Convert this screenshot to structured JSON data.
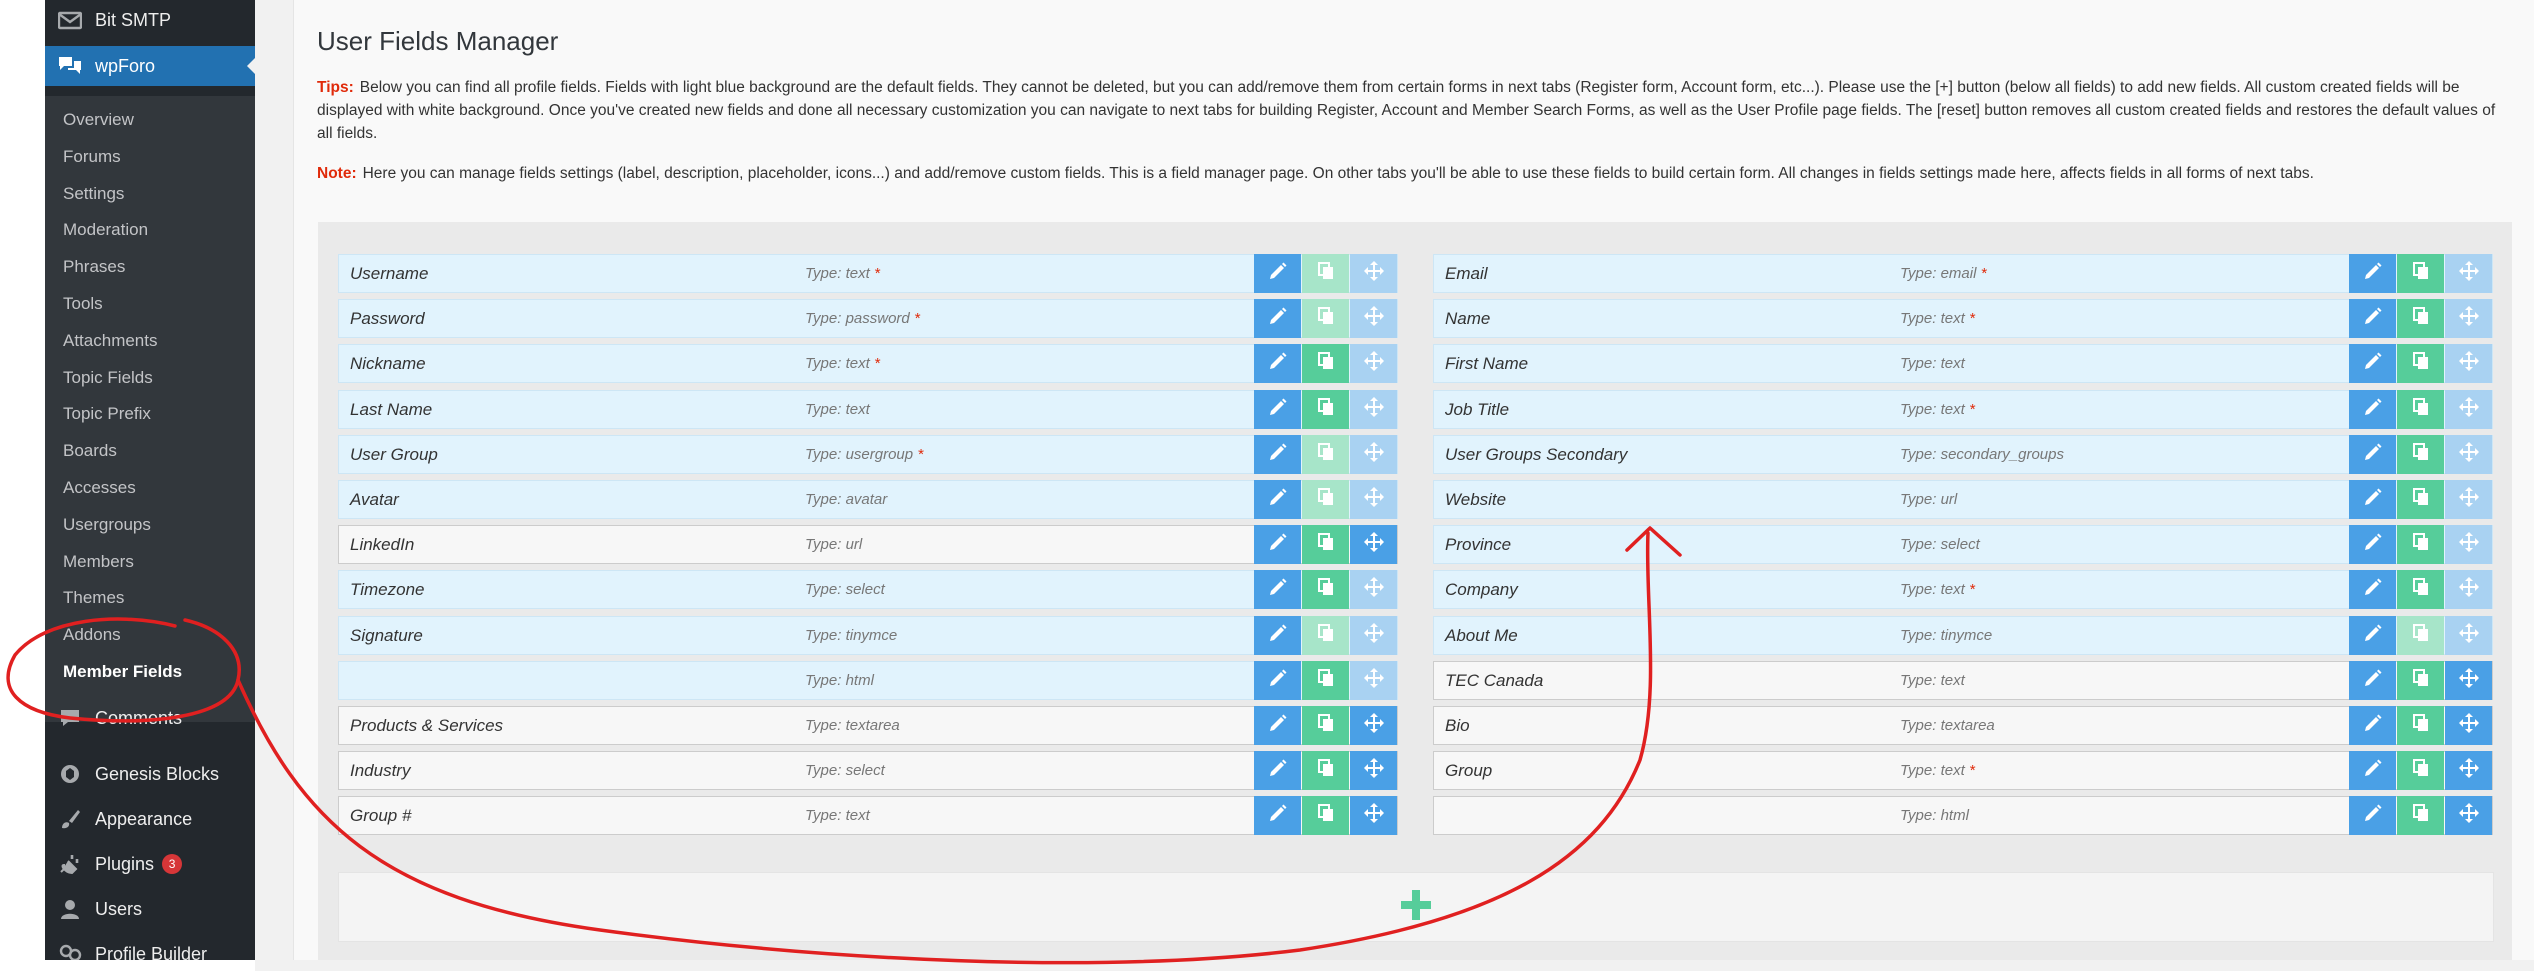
{
  "sidebar": {
    "bit_smtp": "Bit SMTP",
    "wpforo": "wpForo",
    "submenu": [
      {
        "label": "Overview"
      },
      {
        "label": "Forums"
      },
      {
        "label": "Settings"
      },
      {
        "label": "Moderation"
      },
      {
        "label": "Phrases"
      },
      {
        "label": "Tools"
      },
      {
        "label": "Attachments"
      },
      {
        "label": "Topic Fields"
      },
      {
        "label": "Topic Prefix"
      },
      {
        "label": "Boards"
      },
      {
        "label": "Accesses"
      },
      {
        "label": "Usergroups"
      },
      {
        "label": "Members"
      },
      {
        "label": "Themes"
      },
      {
        "label": "Addons"
      },
      {
        "label": "Member Fields"
      }
    ],
    "comments": "Comments",
    "genesis_blocks": "Genesis Blocks",
    "appearance": "Appearance",
    "plugins": "Plugins",
    "plugins_badge": "3",
    "users": "Users",
    "profile_builder": "Profile Builder"
  },
  "page": {
    "title": "User Fields Manager",
    "tips_label": "Tips:",
    "tips_text": "Below you can find all profile fields. Fields with light blue background are the default fields. They cannot be deleted, but you can add/remove them from certain forms in next tabs (Register form, Account form, etc...). Please use the [+] button (below all fields) to add new fields. All custom created fields will be displayed with white background. Once you've created new fields and done all necessary customization you can navigate to next tabs for building Register, Account and Member Search Forms, as well as the User Profile page fields. The [reset] button removes all custom created fields and restores the default values of all fields.",
    "note_label": "Note:",
    "note_text": "Here you can manage fields settings (label, description, placeholder, icons...) and add/remove custom fields. This is a field manager page. On other tabs you'll be able to use these fields to build certain form. All changes in fields settings made here, affects fields in all forms of next tabs."
  },
  "fields_left": [
    {
      "name": "Username",
      "type": "Type: text",
      "required": true,
      "default": true,
      "copy_enabled": false,
      "move_enabled": false
    },
    {
      "name": "Password",
      "type": "Type: password",
      "required": true,
      "default": true,
      "copy_enabled": false,
      "move_enabled": false
    },
    {
      "name": "Nickname",
      "type": "Type: text",
      "required": true,
      "default": true,
      "copy_enabled": true,
      "move_enabled": false
    },
    {
      "name": "Last Name",
      "type": "Type: text",
      "required": false,
      "default": true,
      "copy_enabled": true,
      "move_enabled": false
    },
    {
      "name": "User Group",
      "type": "Type: usergroup",
      "required": true,
      "default": true,
      "copy_enabled": false,
      "move_enabled": false
    },
    {
      "name": "Avatar",
      "type": "Type: avatar",
      "required": false,
      "default": true,
      "copy_enabled": false,
      "move_enabled": false
    },
    {
      "name": "LinkedIn",
      "type": "Type: url",
      "required": false,
      "default": false,
      "copy_enabled": true,
      "move_enabled": true
    },
    {
      "name": "Timezone",
      "type": "Type: select",
      "required": false,
      "default": true,
      "copy_enabled": true,
      "move_enabled": false
    },
    {
      "name": "Signature",
      "type": "Type: tinymce",
      "required": false,
      "default": true,
      "copy_enabled": false,
      "move_enabled": false
    },
    {
      "name": "",
      "type": "Type: html",
      "required": false,
      "default": true,
      "copy_enabled": true,
      "move_enabled": false
    },
    {
      "name": "Products & Services",
      "type": "Type: textarea",
      "required": false,
      "default": false,
      "copy_enabled": true,
      "move_enabled": true
    },
    {
      "name": "Industry",
      "type": "Type: select",
      "required": false,
      "default": false,
      "copy_enabled": true,
      "move_enabled": true
    },
    {
      "name": "Group #",
      "type": "Type: text",
      "required": false,
      "default": false,
      "copy_enabled": true,
      "move_enabled": true
    }
  ],
  "fields_right": [
    {
      "name": "Email",
      "type": "Type: email",
      "required": true,
      "default": true,
      "copy_enabled": true,
      "move_enabled": false
    },
    {
      "name": "Name",
      "type": "Type: text",
      "required": true,
      "default": true,
      "copy_enabled": true,
      "move_enabled": false
    },
    {
      "name": "First Name",
      "type": "Type: text",
      "required": false,
      "default": true,
      "copy_enabled": true,
      "move_enabled": false
    },
    {
      "name": "Job Title",
      "type": "Type: text",
      "required": true,
      "default": true,
      "copy_enabled": true,
      "move_enabled": false
    },
    {
      "name": "User Groups Secondary",
      "type": "Type: secondary_groups",
      "required": false,
      "default": true,
      "copy_enabled": true,
      "move_enabled": false
    },
    {
      "name": "Website",
      "type": "Type: url",
      "required": false,
      "default": true,
      "copy_enabled": true,
      "move_enabled": false
    },
    {
      "name": "Province",
      "type": "Type: select",
      "required": false,
      "default": true,
      "copy_enabled": true,
      "move_enabled": false
    },
    {
      "name": "Company",
      "type": "Type: text",
      "required": true,
      "default": true,
      "copy_enabled": true,
      "move_enabled": false
    },
    {
      "name": "About Me",
      "type": "Type: tinymce",
      "required": false,
      "default": true,
      "copy_enabled": false,
      "move_enabled": false
    },
    {
      "name": "TEC Canada",
      "type": "Type: text",
      "required": false,
      "default": false,
      "copy_enabled": true,
      "move_enabled": true
    },
    {
      "name": "Bio",
      "type": "Type: textarea",
      "required": false,
      "default": false,
      "copy_enabled": true,
      "move_enabled": true
    },
    {
      "name": "Group",
      "type": "Type: text",
      "required": true,
      "default": false,
      "copy_enabled": true,
      "move_enabled": true
    },
    {
      "name": "",
      "type": "Type: html",
      "required": false,
      "default": false,
      "copy_enabled": true,
      "move_enabled": true
    }
  ],
  "colors": {
    "sidebar_bg": "#23282d",
    "submenu_bg": "#32373c",
    "active_menu": "#2271b1",
    "edit_button": "#4aa0e6",
    "copy_button": "#56cd9a",
    "default_field_bg": "#e1f3fd",
    "custom_field_bg": "#f7f7f7",
    "required_marker": "#e02a0a",
    "annotation": "#e02020"
  },
  "icons": [
    "mail-icon",
    "forum-icon",
    "comment-icon",
    "blocks-icon",
    "brush-icon",
    "plug-icon",
    "user-icon",
    "profile-icon",
    "pencil-icon",
    "copy-icon",
    "move-icon",
    "plus-icon"
  ]
}
